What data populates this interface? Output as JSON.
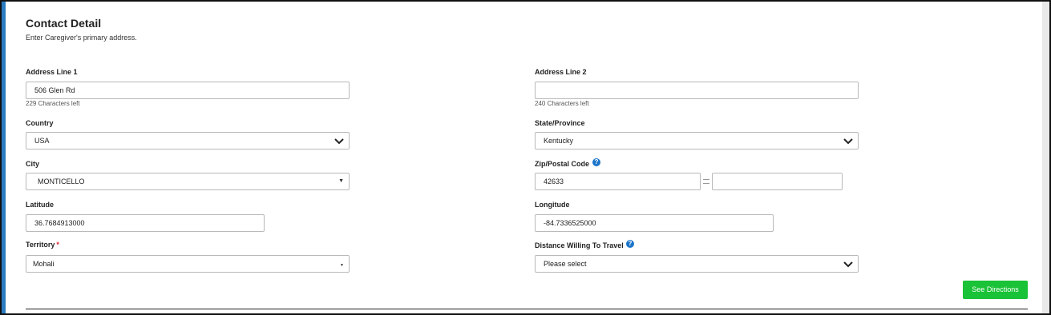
{
  "section": {
    "title": "Contact Detail",
    "subtitle": "Enter Caregiver's primary address."
  },
  "fields": {
    "address1": {
      "label": "Address Line 1",
      "value": "506 Glen Rd",
      "hint": "229 Characters left"
    },
    "address2": {
      "label": "Address Line 2",
      "value": "",
      "hint": "240 Characters left"
    },
    "country": {
      "label": "Country",
      "value": "USA"
    },
    "state": {
      "label": "State/Province",
      "value": "Kentucky"
    },
    "city": {
      "label": "City",
      "value": "MONTICELLO"
    },
    "zip": {
      "label": "Zip/Postal Code",
      "value": "42633",
      "ext": ""
    },
    "latitude": {
      "label": "Latitude",
      "value": "36.7684913000"
    },
    "longitude": {
      "label": "Longitude",
      "value": "-84.7336525000"
    },
    "territory": {
      "label": "Territory",
      "required_mark": "*",
      "value": "Mohali"
    },
    "distance": {
      "label": "Distance Willing To Travel",
      "value": "Please select"
    }
  },
  "icons": {
    "help": "?",
    "select_chevron": "chevron-down-icon",
    "select_caret": "▼"
  },
  "buttons": {
    "see_directions": "See Directions"
  },
  "colors": {
    "accent": "#2b7bc1",
    "button_green": "#19c236",
    "help_blue": "#1b74c9",
    "required_red": "#d9232d"
  }
}
